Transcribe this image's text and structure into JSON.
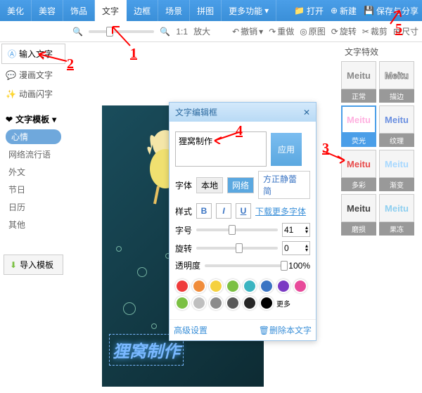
{
  "tabs": [
    "美化",
    "美容",
    "饰品",
    "文字",
    "边框",
    "场景",
    "拼图",
    "更多功能"
  ],
  "active_tab": "文字",
  "top_right": {
    "open": "打开",
    "new": "新建",
    "save": "保存与分享"
  },
  "toolbar": {
    "zoom_ratio": "1:1",
    "zoom_in": "放大",
    "undo": "撤销",
    "redo": "重做",
    "original": "原图",
    "rotate": "旋转",
    "crop": "裁剪",
    "size": "尺寸"
  },
  "left": {
    "input_text": "输入文字",
    "comic_text": "漫画文字",
    "anim_text": "动画闪字",
    "tmpl_header": "文字模板",
    "tmpl_items": [
      "心情",
      "网络流行语",
      "外文",
      "节日",
      "日历",
      "其他"
    ],
    "import": "导入模板"
  },
  "canvas_text": "狸窝制作",
  "dialog": {
    "title": "文字编辑框",
    "text_value": "狸窝制作",
    "apply": "应用",
    "font_label": "字体",
    "font_local": "本地",
    "font_net": "网络",
    "font_name": "方正静蕾简",
    "style_label": "样式",
    "download_fonts": "下载更多字体",
    "size_label": "字号",
    "size_value": "41",
    "rotate_label": "旋转",
    "rotate_value": "0",
    "opacity_label": "透明度",
    "opacity_value": "100%",
    "more": "更多",
    "advanced": "高级设置",
    "delete": "删除本文字"
  },
  "colors": [
    "#ef3b3b",
    "#f08c3a",
    "#f5d13e",
    "#7bc043",
    "#3bb4c1",
    "#3a74c3",
    "#7b3ac3",
    "#e84a9a",
    "#7bc043",
    "#bfbfbf",
    "#8c8c8c",
    "#595959",
    "#262626",
    "#000000"
  ],
  "effects": {
    "title": "文字特效",
    "items": [
      {
        "label": "正常",
        "color": "#888"
      },
      {
        "label": "描边",
        "color": "#444",
        "stroke": true
      },
      {
        "label": "荧光",
        "color": "#ffb0e0",
        "selected": true
      },
      {
        "label": "纹理",
        "color": "#6a8fe0"
      },
      {
        "label": "多彩",
        "color": "#e84a4a"
      },
      {
        "label": "渐变",
        "color": "#a7d8ff"
      },
      {
        "label": "磨损",
        "color": "#444"
      },
      {
        "label": "果冻",
        "color": "#8ecff0"
      }
    ]
  },
  "annotations": {
    "a1": "1",
    "a2": "2",
    "a3": "3",
    "a4": "4",
    "a5": "5"
  }
}
